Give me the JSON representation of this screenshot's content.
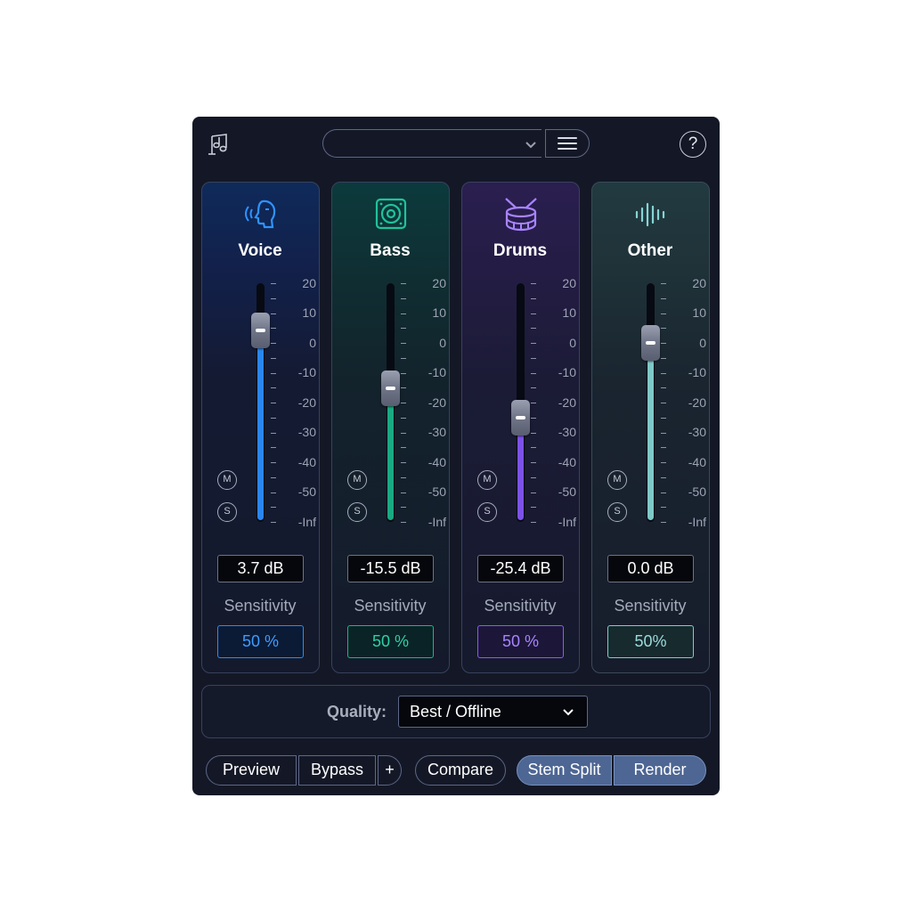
{
  "window": {
    "app_logo": "music-note-logo-icon"
  },
  "top_bar": {
    "preset_value": "",
    "menu_icon": "hamburger-menu-icon",
    "help_label": "?"
  },
  "stems": [
    {
      "name": "Voice",
      "icon": "voice-head-icon",
      "gain": "3.7 dB",
      "sensitivity_label": "Sensitivity",
      "sensitivity": "50 %",
      "accent": "#2b8cf0",
      "fader_level_db": 3.7
    },
    {
      "name": "Bass",
      "icon": "speaker-icon",
      "gain": "-15.5 dB",
      "sensitivity_label": "Sensitivity",
      "sensitivity": "50 %",
      "accent": "#1fb38a",
      "fader_level_db": -15.5
    },
    {
      "name": "Drums",
      "icon": "drum-icon",
      "gain": "-25.4 dB",
      "sensitivity_label": "Sensitivity",
      "sensitivity": "50 %",
      "accent": "#8a5cf0",
      "fader_level_db": -25.4
    },
    {
      "name": "Other",
      "icon": "waveform-icon",
      "gain": "0.0 dB",
      "sensitivity_label": "Sensitivity",
      "sensitivity": "50%",
      "accent": "#7fcccc",
      "fader_level_db": 0.0
    }
  ],
  "scale_labels": [
    "20",
    "10",
    "0",
    "-10",
    "-20",
    "-30",
    "-40",
    "-50",
    "-Inf"
  ],
  "mute_label": "M",
  "solo_label": "S",
  "quality": {
    "label": "Quality:",
    "value": "Best / Offline"
  },
  "buttons": {
    "preview": "Preview",
    "bypass": "Bypass",
    "plus": "+",
    "compare": "Compare",
    "stem_split": "Stem Split",
    "render": "Render"
  }
}
